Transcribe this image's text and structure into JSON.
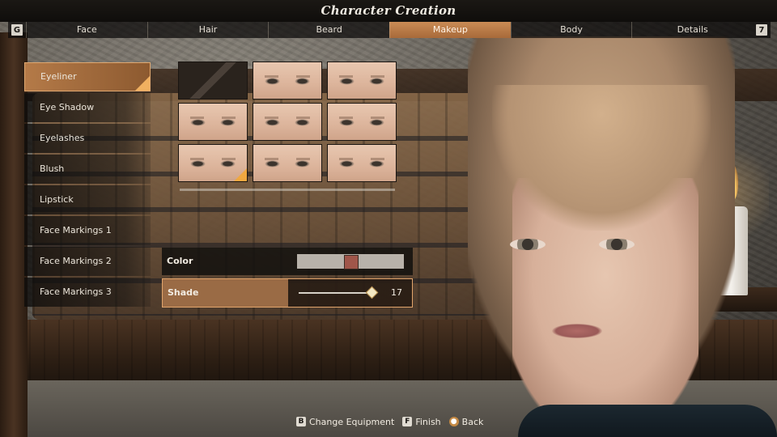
{
  "window": {
    "title": "Character Creation"
  },
  "tabs": {
    "left_key": "G",
    "right_key": "7",
    "items": [
      "Face",
      "Hair",
      "Beard",
      "Makeup",
      "Body",
      "Details"
    ],
    "active": "Makeup"
  },
  "menu": {
    "items": [
      "Eyeliner",
      "Eye Shadow",
      "Eyelashes",
      "Blush",
      "Lipstick",
      "Face Markings 1",
      "Face Markings 2",
      "Face Markings 3"
    ],
    "active": "Eyeliner"
  },
  "swatches": {
    "count": 9,
    "selected_index": 6,
    "first_is_none": true
  },
  "params": {
    "color": {
      "label": "Color",
      "value_hex": "#a0564a"
    },
    "shade": {
      "label": "Shade",
      "value": "17",
      "fraction": 0.96
    }
  },
  "footer": {
    "change_equipment": {
      "key": "B",
      "label": "Change Equipment"
    },
    "finish": {
      "key": "F",
      "label": "Finish"
    },
    "back": {
      "key": "mouse-right-icon",
      "label": "Back"
    }
  },
  "colors": {
    "accent": "#c98b55",
    "highlight": "#f0a840"
  }
}
